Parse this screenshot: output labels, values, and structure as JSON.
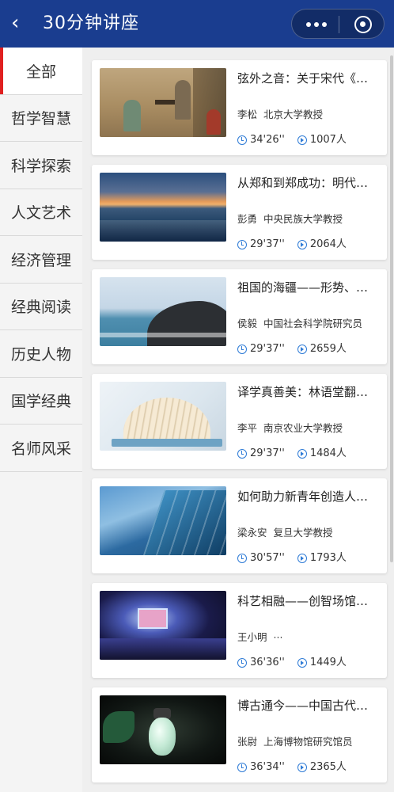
{
  "header": {
    "back_icon": "chevron-left-icon",
    "title": "30分钟讲座",
    "more_icon": "more-dots-icon",
    "close_icon": "target-circle-icon",
    "background": "#1a3d8f"
  },
  "sidebar": {
    "active_index": 0,
    "accent": "#e02020",
    "items": [
      {
        "label": "全部"
      },
      {
        "label": "哲学智慧"
      },
      {
        "label": "科学探索"
      },
      {
        "label": "人文艺术"
      },
      {
        "label": "经济管理"
      },
      {
        "label": "经典阅读"
      },
      {
        "label": "历史人物"
      },
      {
        "label": "国学经典"
      },
      {
        "label": "名师风采"
      }
    ]
  },
  "icons": {
    "duration": "clock-icon",
    "views": "play-circle-icon",
    "color": "#2e7bd6"
  },
  "lectures": [
    {
      "title": "弦外之音：关于宋代《…",
      "speaker": "李松",
      "affiliation": "北京大学教授",
      "duration": "34'26''",
      "views": "1007人",
      "thumb": "song-painting"
    },
    {
      "title": "从郑和到郑成功：明代…",
      "speaker": "彭勇",
      "affiliation": "中央民族大学教授",
      "duration": "29'37''",
      "views": "2064人",
      "thumb": "sea-sunset"
    },
    {
      "title": "祖国的海疆——形势、…",
      "speaker": "侯毅",
      "affiliation": "中国社会科学院研究员",
      "duration": "29'37''",
      "views": "2659人",
      "thumb": "rocky-coast"
    },
    {
      "title": "译学真善美：林语堂翻…",
      "speaker": "李平",
      "affiliation": "南京农业大学教授",
      "duration": "29'37''",
      "views": "1484人",
      "thumb": "open-book"
    },
    {
      "title": "如何助力新青年创造人…",
      "speaker": "梁永安",
      "affiliation": "复旦大学教授",
      "duration": "30'57''",
      "views": "1793人",
      "thumb": "glass-building"
    },
    {
      "title": "科艺相融——创智场馆…",
      "speaker": "王小明",
      "affiliation": "···",
      "duration": "36'36''",
      "views": "1449人",
      "thumb": "stage-hall"
    },
    {
      "title": "博古通今——中国古代…",
      "speaker": "张尉",
      "affiliation": "上海博物馆研究馆员",
      "duration": "36'34''",
      "views": "2365人",
      "thumb": "jade-pendant"
    }
  ]
}
